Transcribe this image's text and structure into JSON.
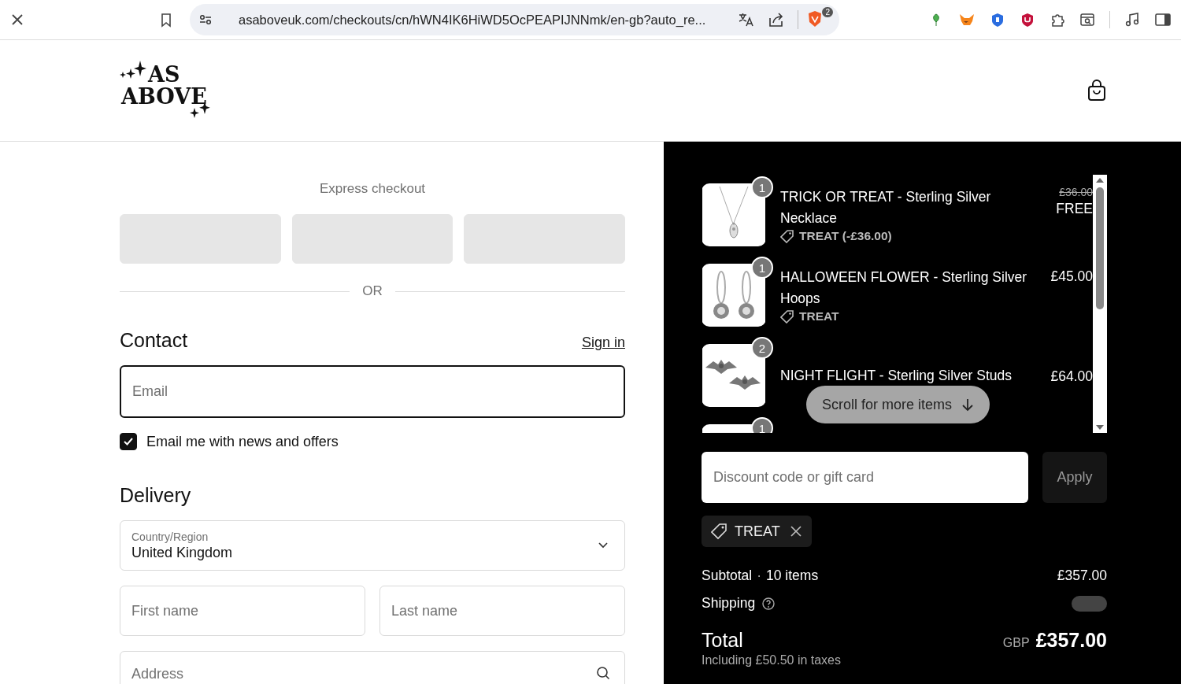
{
  "browser": {
    "url": "asaboveuk.com/checkouts/cn/hWN4IK6HiWD5OcPEAPIJNNmk/en-gb?auto_re...",
    "shield_badge": "2"
  },
  "header": {
    "logo_lines": [
      "AS",
      "ABOVE"
    ]
  },
  "express": {
    "title": "Express checkout",
    "buttons": [
      {
        "loading": true
      },
      {
        "loading": true
      },
      {
        "loading": true
      }
    ]
  },
  "divider_label": "OR",
  "contact": {
    "heading": "Contact",
    "sign_in": "Sign in",
    "email": {
      "placeholder": "Email",
      "focused": true
    },
    "newsletter": {
      "label": "Email me with news and offers",
      "checked": true
    }
  },
  "delivery": {
    "heading": "Delivery",
    "country": {
      "label": "Country/Region",
      "value": "United Kingdom"
    },
    "first_name": {
      "placeholder": "First name"
    },
    "last_name": {
      "placeholder": "Last name"
    },
    "address": {
      "placeholder": "Address"
    }
  },
  "cart": {
    "items": [
      {
        "quantity": "1",
        "title": "TRICK OR TREAT - Sterling Silver Necklace",
        "discount": "TREAT (-£36.00)",
        "original_price": "£36.00",
        "price": "FREE",
        "kind": "picture"
      },
      {
        "quantity": "1",
        "title": "HALLOWEEN FLOWER - Sterling Silver Hoops",
        "discount": "TREAT",
        "price": "£45.00",
        "kind": "picture"
      },
      {
        "quantity": "2",
        "title": "NIGHT FLIGHT - Sterling Silver Studs",
        "price": "£64.00",
        "kind": "picture"
      },
      {
        "quantity": "1",
        "kind": "picture"
      }
    ],
    "scroll_hint": "Scroll for more items"
  },
  "discount": {
    "placeholder": "Discount code or gift card",
    "apply": "Apply"
  },
  "applied_codes": [
    {
      "code": "TREAT"
    }
  ],
  "summary": {
    "subtotal_label": "Subtotal",
    "separator": "·",
    "item_count": "10 items",
    "subtotal": "£357.00",
    "shipping_label": "Shipping",
    "shipping_loading": true,
    "total_label": "Total",
    "currency": "GBP",
    "total": "£357.00",
    "taxes": "Including £50.50 in taxes"
  }
}
